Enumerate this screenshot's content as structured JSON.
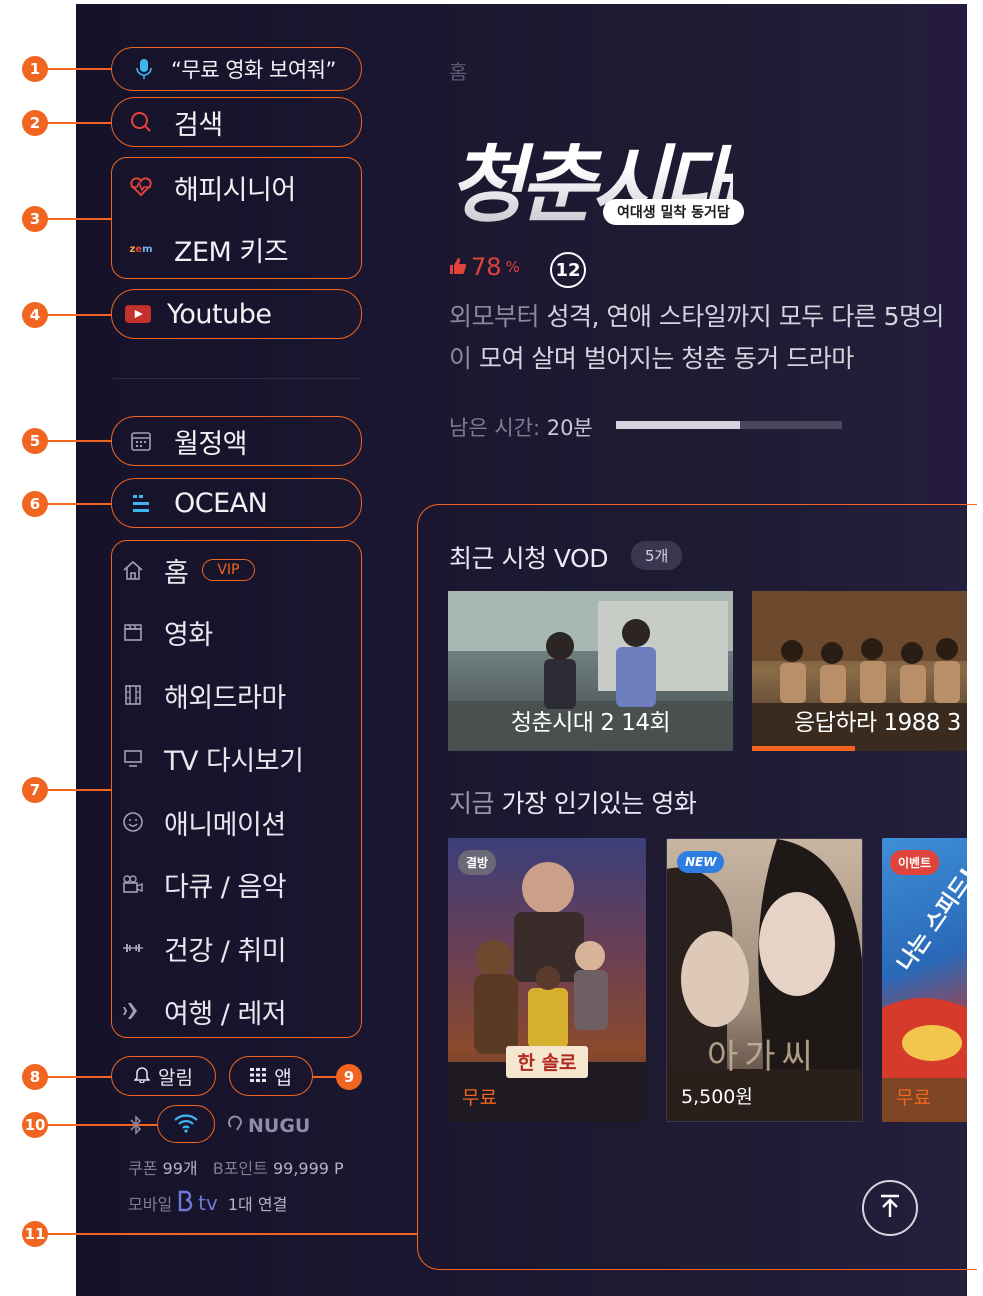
{
  "markers": [
    "1",
    "2",
    "3",
    "4",
    "5",
    "6",
    "7",
    "8",
    "9",
    "10",
    "11"
  ],
  "sidebar": {
    "voice_hint": "“무료 영화 보여줘”",
    "search": "검색",
    "happy_senior": "해피시니어",
    "zem_kids": "ZEM 키즈",
    "youtube": "Youtube",
    "monthly": "월정액",
    "ocean": "OCEAN",
    "menu": [
      {
        "label": "홈",
        "icon": "home-icon"
      },
      {
        "label": "영화",
        "icon": "clapperboard-icon"
      },
      {
        "label": "해외드라마",
        "icon": "film-icon"
      },
      {
        "label": "TV 다시보기",
        "icon": "monitor-icon"
      },
      {
        "label": "애니메이션",
        "icon": "smile-icon"
      },
      {
        "label": "다큐 / 음악",
        "icon": "camera-icon"
      },
      {
        "label": "건강 / 취미",
        "icon": "dumbbell-icon"
      },
      {
        "label": "여행 / 레저",
        "icon": "airplane-icon"
      }
    ],
    "vip_badge": "VIP",
    "alarm": "알림",
    "app": "앱",
    "nugu": "NUGU",
    "coupon_label": "쿠폰",
    "coupon_value": "99개",
    "bpoint_label": "B포인트",
    "bpoint_value": "99,999 P",
    "mobile_label": "모바일",
    "btv_label": "tv",
    "mobile_conn": "1대 연결"
  },
  "hero": {
    "breadcrumb": "홈",
    "title_logo": "청춘시대",
    "title_sub": "여대생 밀착 동거담",
    "like_pct": "78",
    "like_unit": "%",
    "age_rating": "12",
    "desc_line1_a": "외모부터",
    "desc_line1_b": " 성격, 연애 스타일까지 모두 다른 5명의",
    "desc_line2_a": "이",
    "desc_line2_b": " 모여 살며 벌어지는 청춘 동거 드라마",
    "remain_label": "남은 시간:",
    "remain_value": " 20분",
    "progress": 0.55
  },
  "recent": {
    "title": "최근 시청 VOD",
    "count": "5개",
    "items": [
      {
        "title": "청춘시대 2 14회",
        "progress": 0.0
      },
      {
        "title": "응답하라 1988 3",
        "progress": 0.48
      }
    ]
  },
  "popular": {
    "title_a": "지금",
    "title_b": " 가장 인기있는 영화",
    "items": [
      {
        "badge": "결방",
        "price": "무료",
        "poster_title": "한 솔로"
      },
      {
        "badge": "NEW",
        "price": "5,500원",
        "poster_title": "아가씨"
      },
      {
        "badge": "이벤트",
        "price": "무료",
        "poster_title": "나는 스피드! 나는 스피드!"
      }
    ]
  },
  "colors": {
    "accent": "#f0651f",
    "bg": "#1b1730",
    "like": "#e0433b"
  }
}
